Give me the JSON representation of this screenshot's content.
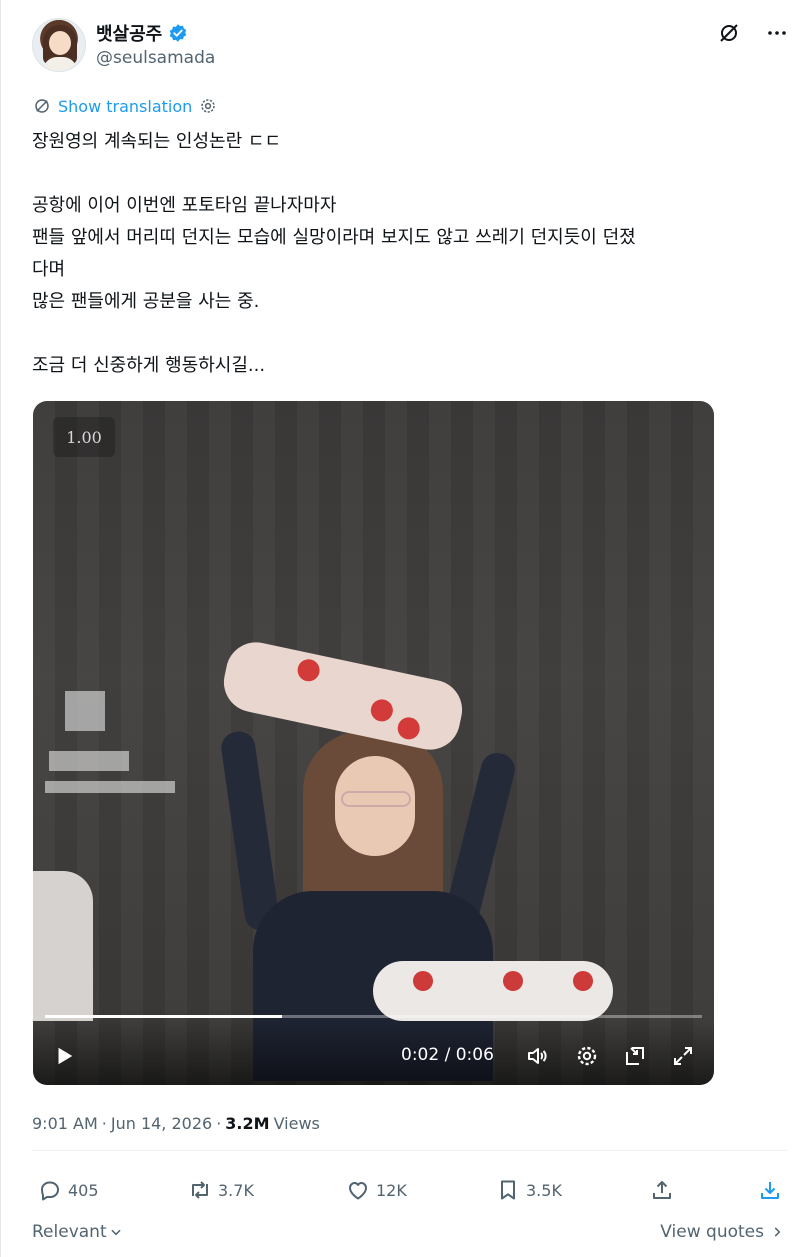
{
  "author": {
    "display_name": "뱃살공주",
    "handle": "@seulsamada",
    "verified": true
  },
  "translate_label": "Show translation",
  "tweet_lines": [
    "장원영의 계속되는 인성논란 ㄷㄷ",
    "",
    "공항에 이어 이번엔 포토타임 끝나자마자",
    "팬들 앞에서 머리띠 던지는 모습에 실망이라며 보지도 않고 쓰레기 던지듯이 던졌",
    "다며",
    "많은 팬들에게 공분을 사는 중.",
    "",
    "조금 더 신중하게 행동하시길..."
  ],
  "video": {
    "speed_label": "1.00",
    "time": "0:02 / 0:06",
    "progress": 0.36
  },
  "meta": {
    "time": "9:01 AM",
    "date": "Jun 14, 2026",
    "views_count": "3.2M",
    "views_label": "Views"
  },
  "actions": {
    "replies": "405",
    "reposts": "3.7K",
    "likes": "12K",
    "bookmarks": "3.5K"
  },
  "footer": {
    "sort_label": "Relevant",
    "view_quotes": "View quotes"
  },
  "colors": {
    "accent": "#1d9bf0",
    "text": "#0f1419",
    "muted": "#536471"
  }
}
